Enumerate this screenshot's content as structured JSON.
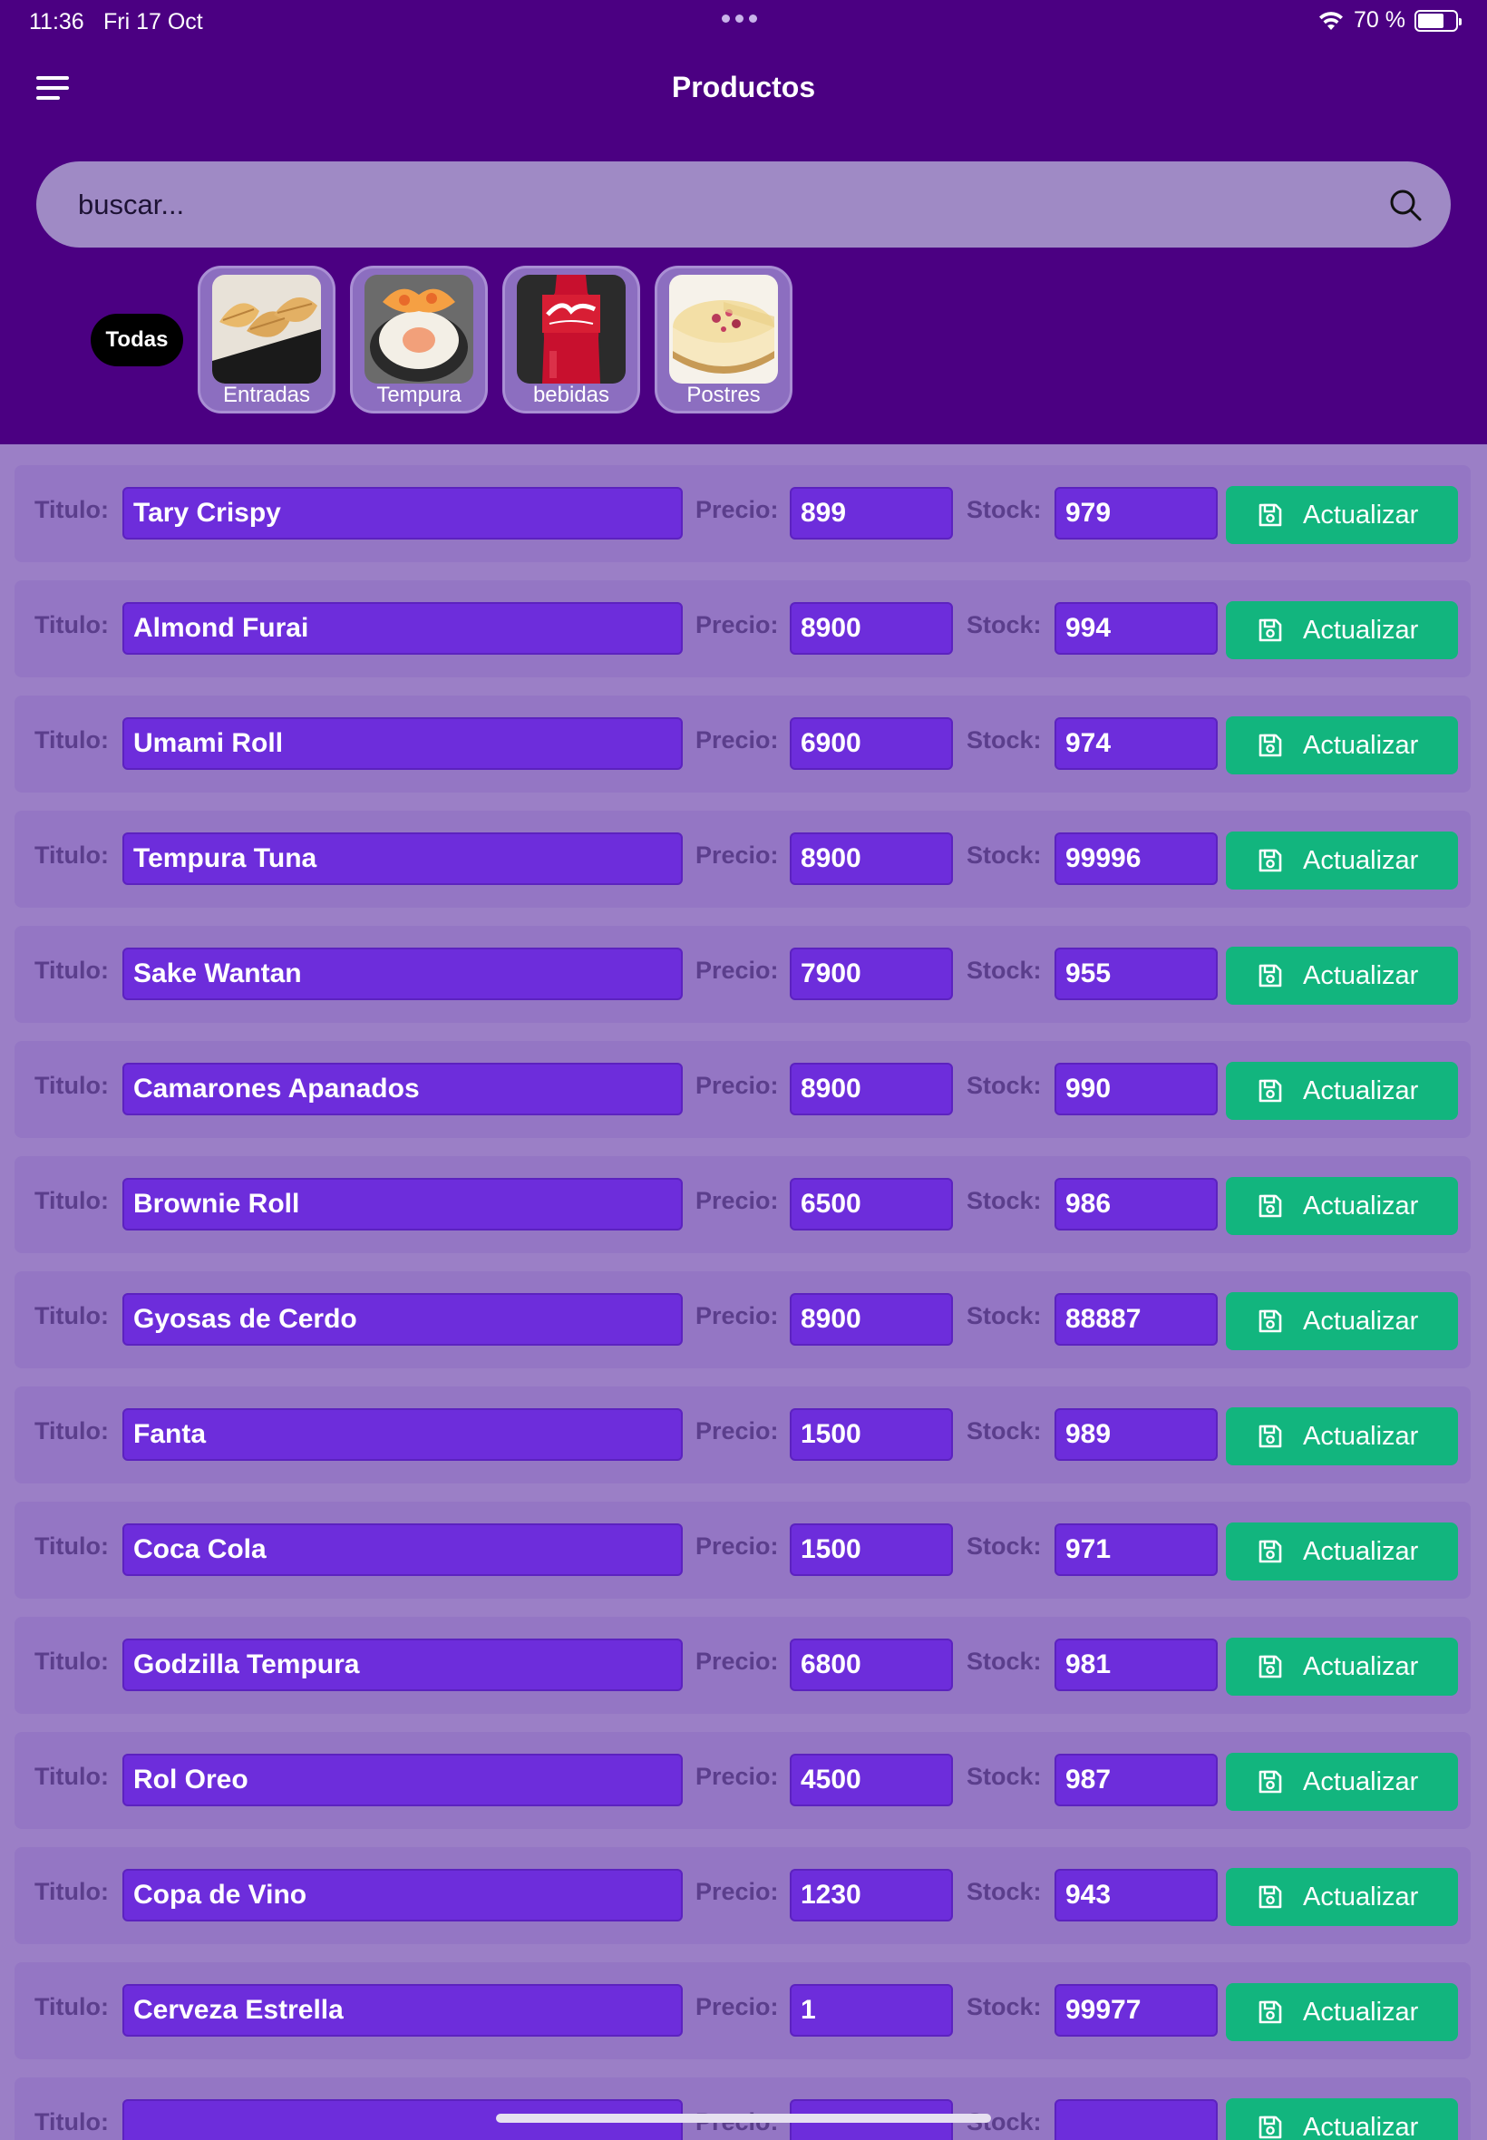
{
  "status_bar": {
    "time": "11:36",
    "date": "Fri 17 Oct",
    "battery": "70 %",
    "battery_level": 0.7
  },
  "header": {
    "title": "Productos",
    "menu_icon": "hamburger-menu-icon"
  },
  "search": {
    "placeholder": "buscar...",
    "icon": "search-icon"
  },
  "filters": {
    "all_label": "Todas",
    "categories": [
      {
        "label": "Entradas",
        "image": "gyoza-photo"
      },
      {
        "label": "Tempura",
        "image": "sushi-roll-photo"
      },
      {
        "label": "bebidas",
        "image": "coca-cola-bottle-photo"
      },
      {
        "label": "Postres",
        "image": "cheesecake-photo"
      }
    ]
  },
  "labels": {
    "title": "Titulo:",
    "price": "Precio:",
    "stock": "Stock:",
    "update": "Actualizar"
  },
  "colors": {
    "header_bg": "#4b0082",
    "page_bg": "#9b7fc6",
    "field_bg": "#6d2ddb",
    "button_bg": "#12b57e"
  },
  "products": [
    {
      "title": "Tary Crispy",
      "price": "899",
      "stock": "979"
    },
    {
      "title": "Almond Furai",
      "price": "8900",
      "stock": "994"
    },
    {
      "title": "Umami Roll",
      "price": "6900",
      "stock": "974"
    },
    {
      "title": "Tempura Tuna",
      "price": "8900",
      "stock": "99996"
    },
    {
      "title": "Sake Wantan",
      "price": "7900",
      "stock": "955"
    },
    {
      "title": "Camarones Apanados",
      "price": "8900",
      "stock": "990"
    },
    {
      "title": "Brownie Roll",
      "price": "6500",
      "stock": "986"
    },
    {
      "title": "Gyosas de Cerdo",
      "price": "8900",
      "stock": "88887"
    },
    {
      "title": "Fanta",
      "price": "1500",
      "stock": "989"
    },
    {
      "title": "Coca Cola",
      "price": "1500",
      "stock": "971"
    },
    {
      "title": "Godzilla Tempura",
      "price": "6800",
      "stock": "981"
    },
    {
      "title": "Rol Oreo",
      "price": "4500",
      "stock": "987"
    },
    {
      "title": "Copa de Vino",
      "price": "1230",
      "stock": "943"
    },
    {
      "title": "Cerveza Estrella",
      "price": "1",
      "stock": "99977"
    },
    {
      "title": "",
      "price": "",
      "stock": ""
    }
  ]
}
